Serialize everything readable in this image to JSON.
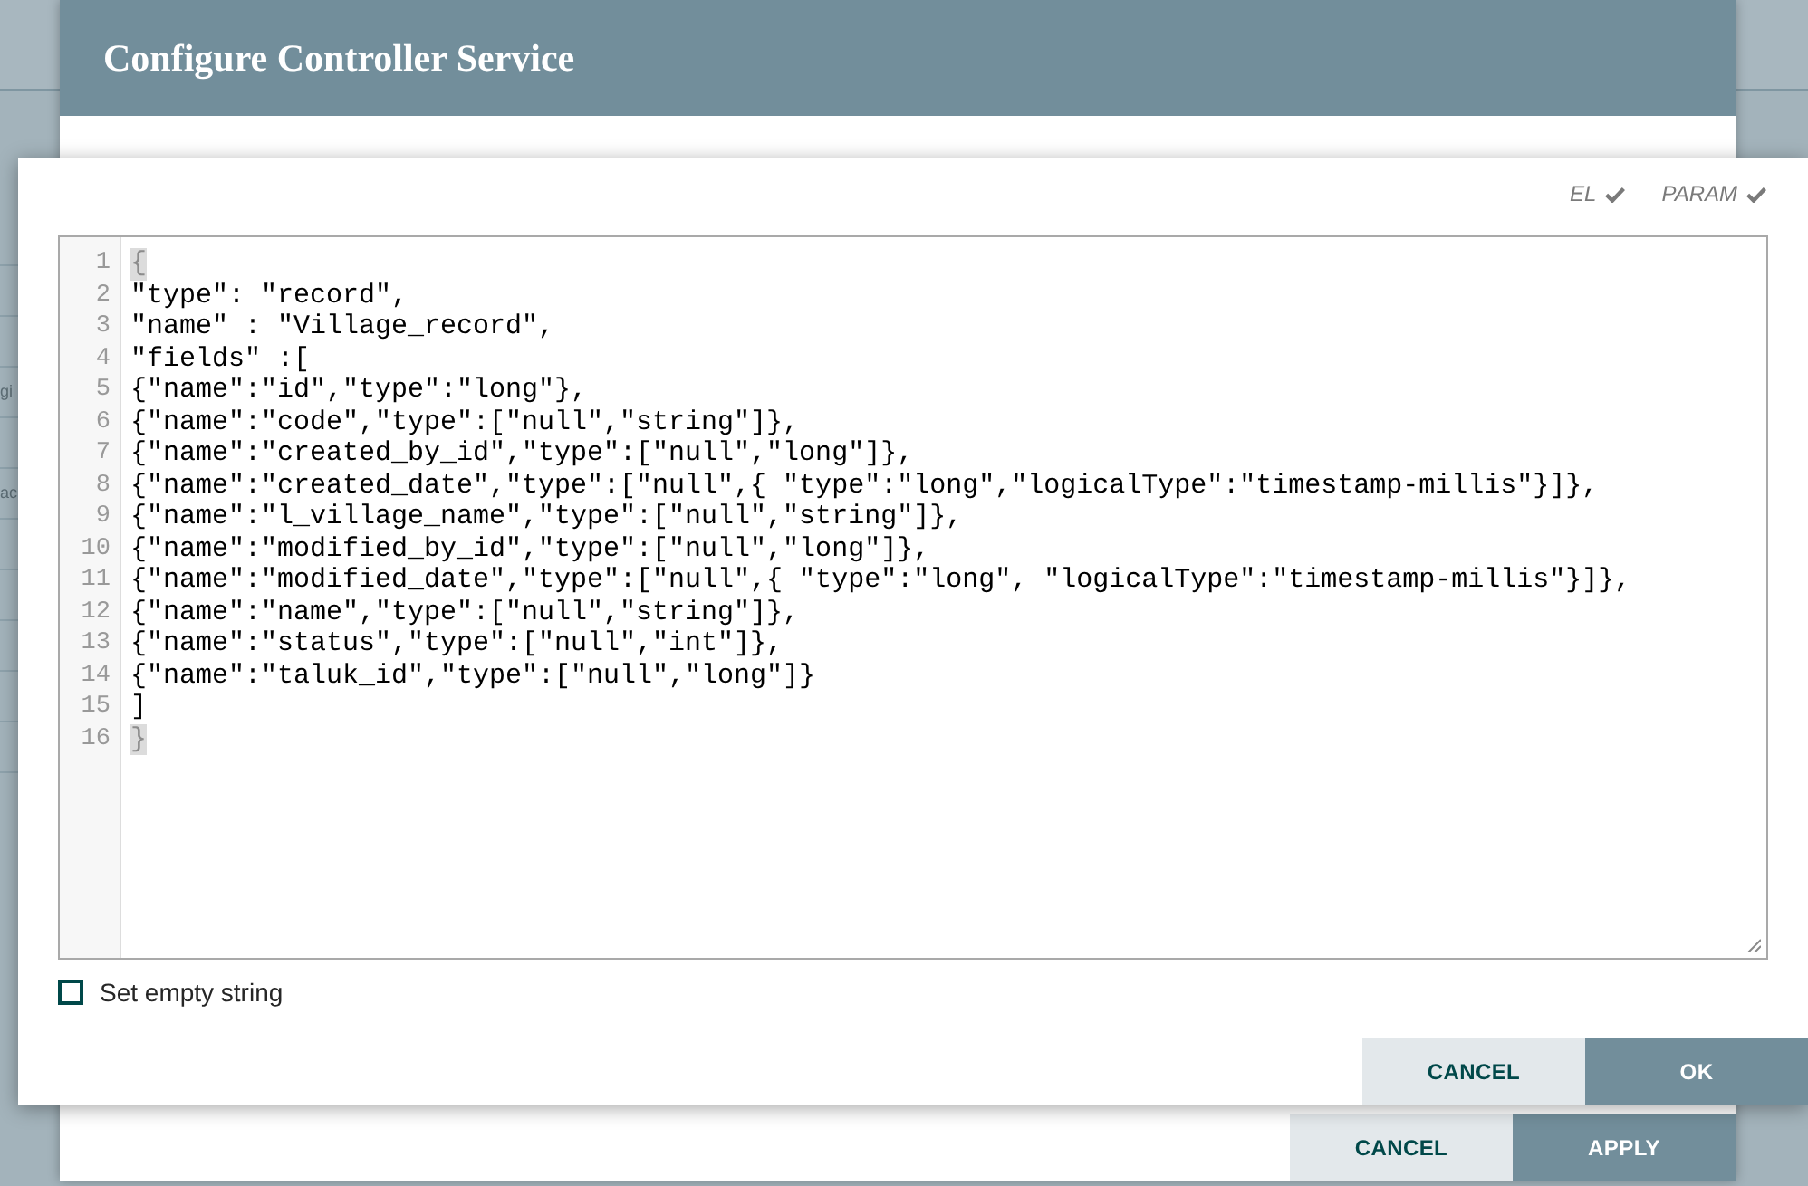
{
  "background_table": {
    "cell_fragments": [
      "gi",
      "ac"
    ]
  },
  "dialog": {
    "title": "Configure Controller Service",
    "buttons": [
      {
        "label": "CANCEL",
        "kind": "secondary"
      },
      {
        "label": "APPLY",
        "kind": "primary"
      }
    ]
  },
  "editor_popup": {
    "flags": [
      {
        "label": "EL",
        "checked": true
      },
      {
        "label": "PARAM",
        "checked": true
      }
    ],
    "code_lines": [
      {
        "number": "1",
        "text": "{",
        "bracket_match": true
      },
      {
        "number": "2",
        "text": "\"type\": \"record\",",
        "bracket_match": false
      },
      {
        "number": "3",
        "text": "\"name\" : \"Village_record\",",
        "bracket_match": false
      },
      {
        "number": "4",
        "text": "\"fields\" :[",
        "bracket_match": false
      },
      {
        "number": "5",
        "text": "{\"name\":\"id\",\"type\":\"long\"},",
        "bracket_match": false
      },
      {
        "number": "6",
        "text": "{\"name\":\"code\",\"type\":[\"null\",\"string\"]},",
        "bracket_match": false
      },
      {
        "number": "7",
        "text": "{\"name\":\"created_by_id\",\"type\":[\"null\",\"long\"]},",
        "bracket_match": false
      },
      {
        "number": "8",
        "text": "{\"name\":\"created_date\",\"type\":[\"null\",{ \"type\":\"long\",\"logicalType\":\"timestamp-millis\"}]},",
        "bracket_match": false
      },
      {
        "number": "9",
        "text": "{\"name\":\"l_village_name\",\"type\":[\"null\",\"string\"]},",
        "bracket_match": false
      },
      {
        "number": "10",
        "text": "{\"name\":\"modified_by_id\",\"type\":[\"null\",\"long\"]},",
        "bracket_match": false
      },
      {
        "number": "11",
        "text": "{\"name\":\"modified_date\",\"type\":[\"null\",{ \"type\":\"long\", \"logicalType\":\"timestamp-millis\"}]},",
        "bracket_match": false
      },
      {
        "number": "12",
        "text": "{\"name\":\"name\",\"type\":[\"null\",\"string\"]},",
        "bracket_match": false
      },
      {
        "number": "13",
        "text": "{\"name\":\"status\",\"type\":[\"null\",\"int\"]},",
        "bracket_match": false
      },
      {
        "number": "14",
        "text": "{\"name\":\"taluk_id\",\"type\":[\"null\",\"long\"]}",
        "bracket_match": false
      },
      {
        "number": "15",
        "text": "]",
        "bracket_match": false
      },
      {
        "number": "16",
        "text": "}",
        "bracket_match": true
      }
    ],
    "set_empty_string": {
      "label": "Set empty string",
      "checked": false
    },
    "buttons": [
      {
        "label": "CANCEL",
        "kind": "secondary"
      },
      {
        "label": "OK",
        "kind": "primary"
      }
    ]
  }
}
